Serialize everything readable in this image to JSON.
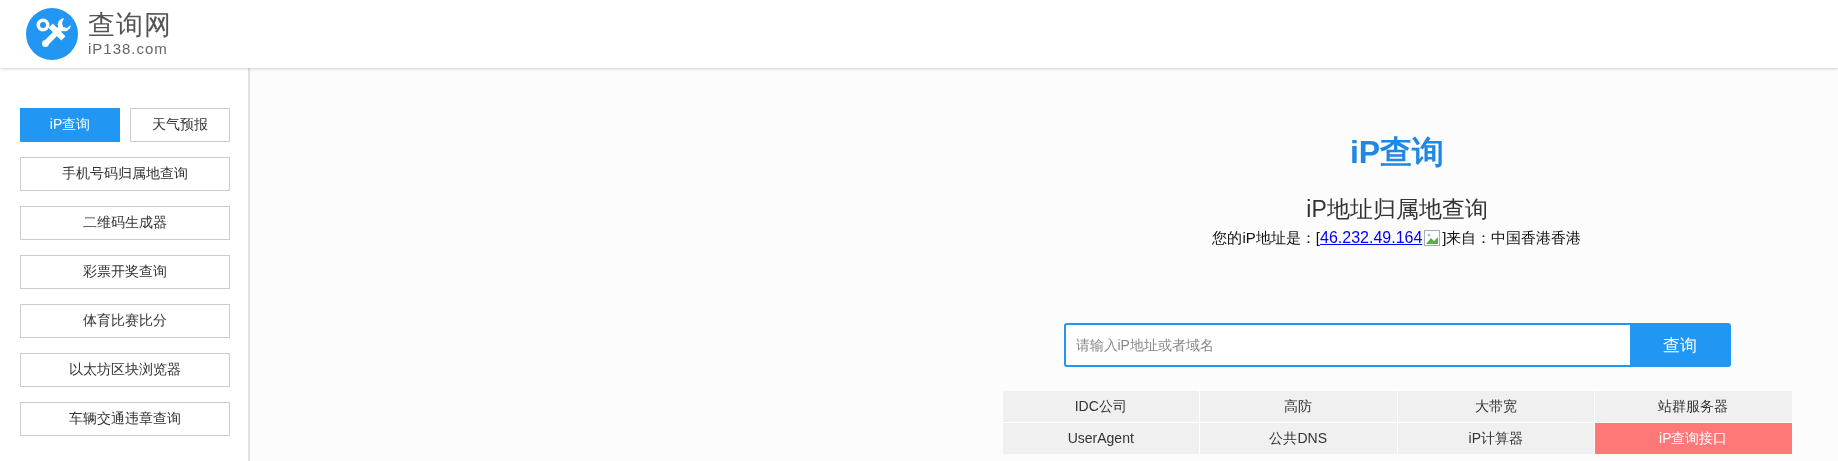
{
  "header": {
    "logo_title": "查询网",
    "logo_subtitle": "iP138.com"
  },
  "sidebar": {
    "items": [
      {
        "label": "iP查询",
        "selected": true,
        "half": true
      },
      {
        "label": "天气预报",
        "selected": false,
        "half": true
      },
      {
        "label": "手机号码归属地查询",
        "selected": false,
        "half": false
      },
      {
        "label": "二维码生成器",
        "selected": false,
        "half": false
      },
      {
        "label": "彩票开奖查询",
        "selected": false,
        "half": false
      },
      {
        "label": "体育比赛比分",
        "selected": false,
        "half": false
      },
      {
        "label": "以太坊区块浏览器",
        "selected": false,
        "half": false
      },
      {
        "label": "车辆交通违章查询",
        "selected": false,
        "half": false
      }
    ]
  },
  "main": {
    "title": "iP查询",
    "subtitle": "iP地址归属地查询",
    "info": {
      "prefix": "您的iP地址是：[",
      "ip": "46.232.49.164",
      "suffix": "]来自：中国香港香港"
    },
    "search": {
      "placeholder": "请输入iP地址或者域名",
      "button": "查询"
    },
    "links": [
      {
        "label": "IDC公司",
        "highlighted": false
      },
      {
        "label": "高防",
        "highlighted": false
      },
      {
        "label": "大带宽",
        "highlighted": false
      },
      {
        "label": "站群服务器",
        "highlighted": false
      },
      {
        "label": "UserAgent",
        "highlighted": false
      },
      {
        "label": "公共DNS",
        "highlighted": false
      },
      {
        "label": "iP计算器",
        "highlighted": false
      },
      {
        "label": "iP查询接口",
        "highlighted": true
      }
    ]
  }
}
